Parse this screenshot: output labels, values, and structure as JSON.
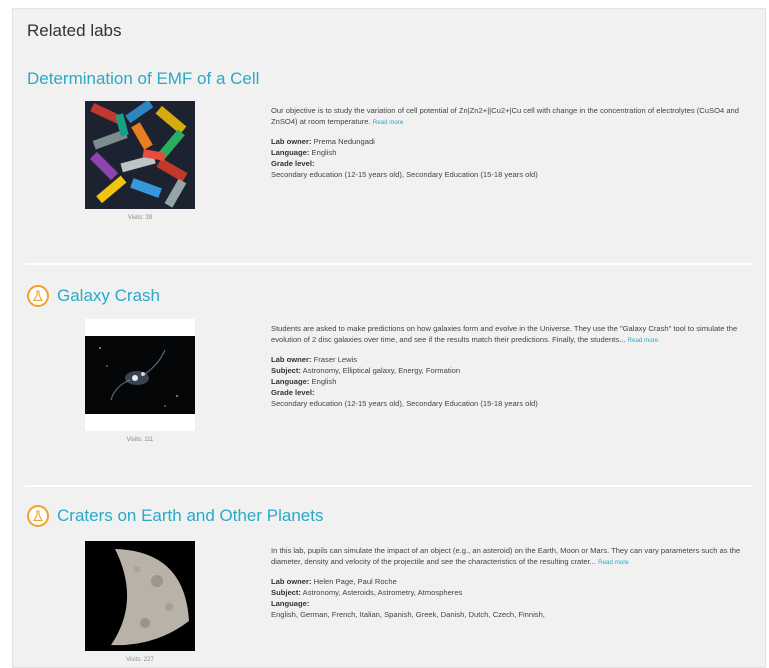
{
  "section_title": "Related labs",
  "labs": [
    {
      "title": "Determination of EMF of a Cell",
      "visits": "Visits: 39",
      "description": "Our objective is to study the variation of cell potential of Zn|Zn2+||Cu2+|Cu cell with change in the concentration of electrolytes (CuSO4 and ZnSO4) at room temperature.",
      "read_more": "Read more",
      "owner_label": "Lab owner:",
      "owner": "Prema Nedungadi",
      "language_label": "Language:",
      "language": "English",
      "grade_label": "Grade level:",
      "grade": "Secondary education (12-15 years old), Secondary Education (15-18 years old)"
    },
    {
      "title": "Galaxy Crash",
      "visits": "Visits: 111",
      "description": "Students are asked to make predictions on how galaxies form and evolve in the Universe. They use the \"Galaxy Crash\" tool to simulate the evolution of 2 disc galaxies over time, and see if the results match their predictions. Finally, the students...",
      "read_more": "Read more",
      "owner_label": "Lab owner:",
      "owner": "Fraser Lewis",
      "subject_label": "Subject:",
      "subject": "Astronomy,  Elliptical galaxy,  Energy,  Formation",
      "language_label": "Language:",
      "language": "English",
      "grade_label": "Grade level:",
      "grade": "Secondary education (12-15 years old), Secondary Education (15-18 years old)"
    },
    {
      "title": "Craters on Earth and Other Planets",
      "visits": "Visits: 227",
      "description": "In this lab, pupils can simulate the impact of an object (e.g., an asteroid) on the Earth, Moon or Mars. They can vary parameters such as the diameter, density and velocity of the projectile and see the characteristics of the resulting crater...",
      "read_more": "Read more",
      "owner_label": "Lab owner:",
      "owner": "Helen Page, Paul Roche",
      "subject_label": "Subject:",
      "subject": "Astronomy,  Asteroids,  Astrometry,  Atmospheres",
      "language_label": "Language:",
      "language": "English, German, French, Italian, Spanish, Greek, Danish, Dutch, Czech, Finnish,"
    }
  ],
  "colors": {
    "link": "#2aa9c9",
    "icon_ring": "#f0a12c",
    "panel": "#f1f1f1"
  }
}
